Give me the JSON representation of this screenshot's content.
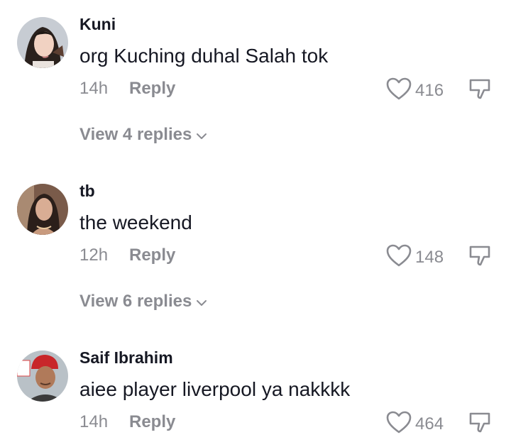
{
  "comments": [
    {
      "username": "Kuni",
      "text": "org Kuching duhal Salah tok",
      "time": "14h",
      "reply_label": "Reply",
      "likes": "416",
      "view_replies": "View 4 replies"
    },
    {
      "username": "tb",
      "text": "the weekend",
      "time": "12h",
      "reply_label": "Reply",
      "likes": "148",
      "view_replies": "View 6 replies"
    },
    {
      "username": "Saif Ibrahim",
      "text": "aiee player liverpool ya nakkkk",
      "time": "14h",
      "reply_label": "Reply",
      "likes": "464"
    }
  ],
  "icons": {
    "like": "heart-outline-icon",
    "dislike": "thumbs-down-outline-icon",
    "expand": "chevron-down-icon"
  },
  "colors": {
    "primary_text": "#161823",
    "secondary_text": "#8a8b91"
  }
}
